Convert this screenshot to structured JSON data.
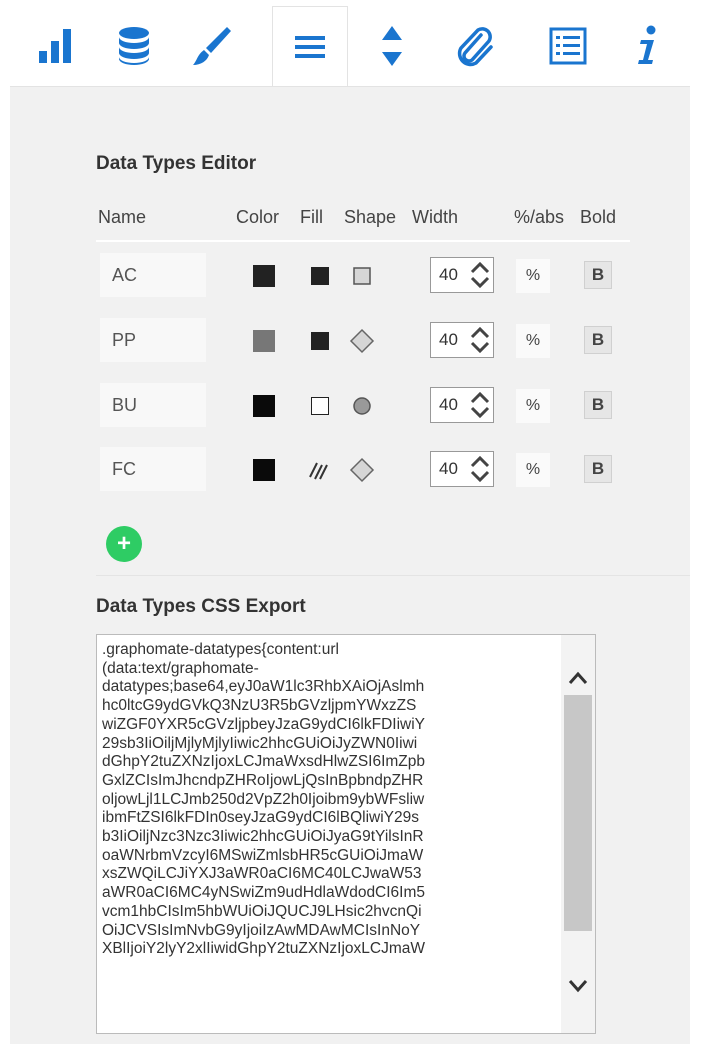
{
  "toolbar": {
    "icons": [
      "bar-chart-icon",
      "database-icon",
      "brush-icon",
      "menu-lines-icon",
      "sort-arrows-icon",
      "paperclip-icon",
      "list-icon",
      "info-icon"
    ],
    "active_index": 3,
    "accent_color": "#1a75cf"
  },
  "editor": {
    "title": "Data Types Editor",
    "columns": {
      "name": "Name",
      "color": "Color",
      "fill": "Fill",
      "shape": "Shape",
      "width": "Width",
      "pct_abs": "%/abs",
      "bold": "Bold"
    },
    "rows": [
      {
        "name": "AC",
        "color": "#222222",
        "fill": "solid-dark",
        "shape": "square-icon",
        "width": "40",
        "pct": "%",
        "bold": "B"
      },
      {
        "name": "PP",
        "color": "#777777",
        "fill": "solid-dark",
        "shape": "diamond-icon",
        "width": "40",
        "pct": "%",
        "bold": "B"
      },
      {
        "name": "BU",
        "color": "#0a0a0a",
        "fill": "empty",
        "shape": "circle-icon",
        "width": "40",
        "pct": "%",
        "bold": "B"
      },
      {
        "name": "FC",
        "color": "#0a0a0a",
        "fill": "hatched",
        "shape": "diamond-icon",
        "width": "40",
        "pct": "%",
        "bold": "B"
      }
    ],
    "add_label": "+"
  },
  "export": {
    "title": "Data Types CSS Export",
    "text": ".graphomate-datatypes{content:url\n(data:text/graphomate-\ndatatypes;base64,eyJ0aW1lc3RhbXAiOjAslmh\nhc0ltcG9ydGVkQ3NzU3R5bGVzljpmYWxzZS\nwiZGF0YXR5cGVzljpbeyJzaG9ydCI6lkFDIiwiY\n29sb3IiOiljMjlyMjlyIiwic2hhcGUiOiJyZWN0Iiwi\ndGhpY2tuZXNzIjoxLCJmaWxsdHlwZSI6ImZpb\nGxlZCIsImJhcndpZHRoIjowLjQsInBpbndpZHR\noljowLjl1LCJmb250d2VpZ2h0Ijoibm9ybWFsliw\nibmFtZSI6lkFDIn0seyJzaG9ydCI6lBQliwiY29s\nb3IiOiljNzc3Nzc3Iiwic2hhcGUiOiJyaG9tYilsInR\noaWNrbmVzcyI6MSwiZmlsbHR5cGUiOiJmaW\nxsZWQiLCJiYXJ3aWR0aCI6MC40LCJwaW53\naWR0aCI6MC4yNSwiZm9udHdlaWdodCI6Im5\nvcm1hbCIsIm5hbWUiOiJQUCJ9LHsic2hvcnQi\nOiJCVSIsImNvbG9yIjoiIzAwMDAwMCIsInNoY\nXBlIjoiY2lyY2xlIiwidGhpY2tuZXNzIjoxLCJmaW"
  }
}
